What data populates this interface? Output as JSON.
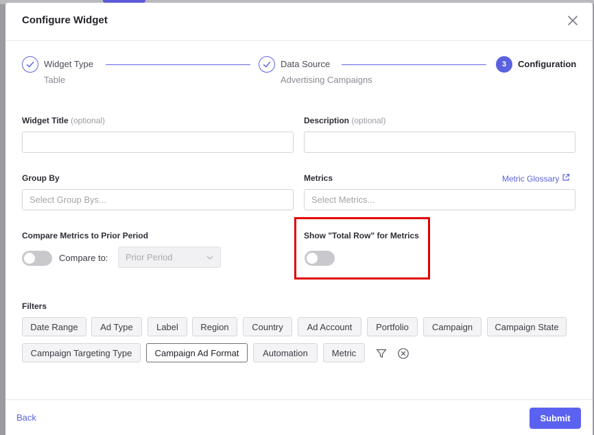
{
  "modal": {
    "title": "Configure Widget"
  },
  "stepper": {
    "steps": [
      {
        "number": "",
        "title": "Widget Type",
        "subtitle": "Table",
        "state": "complete"
      },
      {
        "number": "",
        "title": "Data Source",
        "subtitle": "Advertising Campaigns",
        "state": "complete"
      },
      {
        "number": "3",
        "title": "Configuration",
        "subtitle": "",
        "state": "active"
      }
    ]
  },
  "form": {
    "widget_title": {
      "label": "Widget Title",
      "optional": "(optional)",
      "value": "",
      "placeholder": ""
    },
    "description": {
      "label": "Description",
      "optional": "(optional)",
      "value": "",
      "placeholder": ""
    },
    "group_by": {
      "label": "Group By",
      "placeholder": "Select Group Bys..."
    },
    "metrics": {
      "label": "Metrics",
      "placeholder": "Select Metrics...",
      "glossary_link": "Metric Glossary"
    },
    "compare": {
      "label": "Compare Metrics to Prior Period",
      "toggle_on": false,
      "compare_to_label": "Compare to:",
      "selected_option": "Prior Period"
    },
    "total_row": {
      "label": "Show \"Total Row\" for Metrics",
      "toggle_on": false
    }
  },
  "filters": {
    "label": "Filters",
    "chips": [
      {
        "label": "Date Range",
        "selected": false
      },
      {
        "label": "Ad Type",
        "selected": false
      },
      {
        "label": "Label",
        "selected": false
      },
      {
        "label": "Region",
        "selected": false
      },
      {
        "label": "Country",
        "selected": false
      },
      {
        "label": "Ad Account",
        "selected": false
      },
      {
        "label": "Portfolio",
        "selected": false
      },
      {
        "label": "Campaign",
        "selected": false
      },
      {
        "label": "Campaign State",
        "selected": false
      },
      {
        "label": "Campaign Targeting Type",
        "selected": false
      },
      {
        "label": "Campaign Ad Format",
        "selected": true
      },
      {
        "label": "Automation",
        "selected": false
      },
      {
        "label": "Metric",
        "selected": false
      }
    ]
  },
  "footer": {
    "back_label": "Back",
    "submit_label": "Submit"
  },
  "colors": {
    "accent": "#5b62e0",
    "highlight": "#e00000"
  }
}
